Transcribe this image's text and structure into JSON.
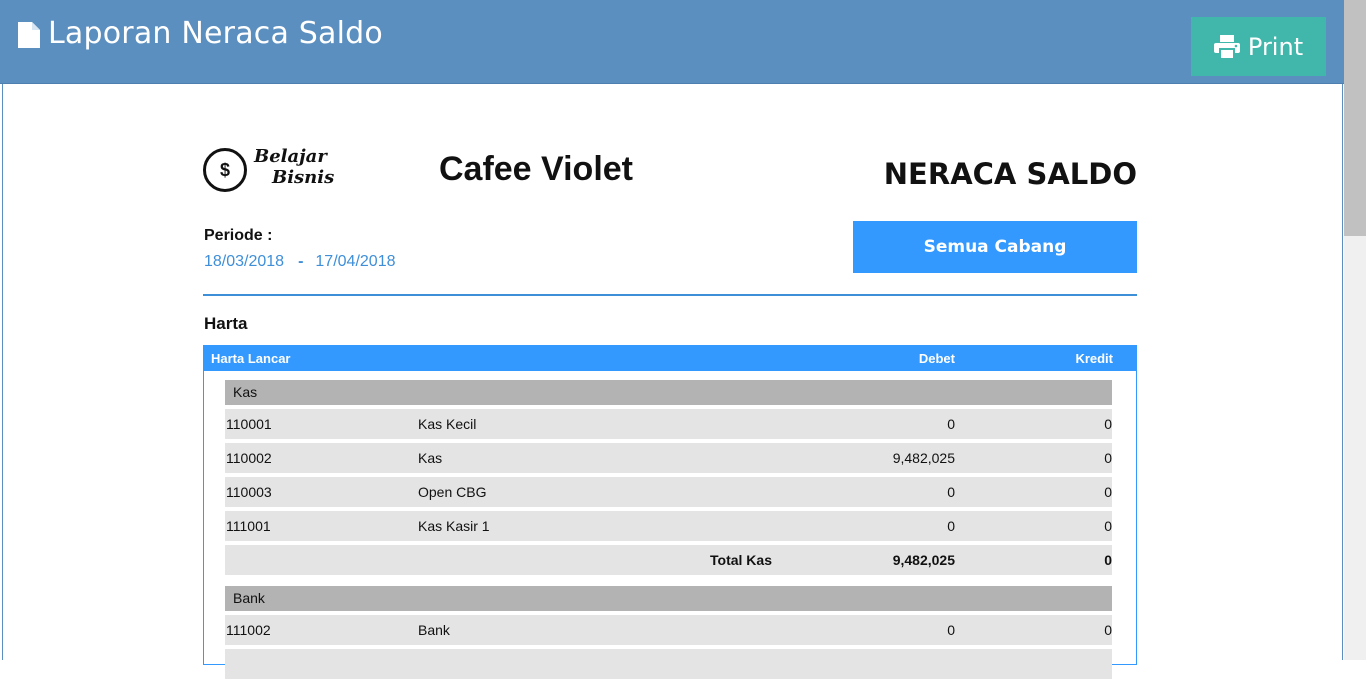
{
  "header": {
    "title": "Laporan Neraca Saldo",
    "print_label": "Print",
    "icons": [
      "document-icon",
      "printer-icon"
    ],
    "colors": {
      "bar": "#5b8fc0",
      "print_button": "#41b7ac"
    }
  },
  "report": {
    "logo_text": [
      "Belajar",
      "Bisnis"
    ],
    "company": "Cafee Violet",
    "title": "NERACA SALDO",
    "periode_label": "Periode :",
    "periode_start": "18/03/2018",
    "periode_sep": "-",
    "periode_end": "17/04/2018",
    "branch_button": "Semua  Cabang",
    "accent": "#3399ff"
  },
  "section": {
    "title": "Harta",
    "table_header": {
      "name": "Harta Lancar",
      "debet": "Debet",
      "kredit": "Kredit"
    },
    "groups": [
      {
        "name": "Kas",
        "rows": [
          {
            "code": "110001",
            "name": "Kas Kecil",
            "debet": "0",
            "kredit": "0"
          },
          {
            "code": "110002",
            "name": "Kas",
            "debet": "9,482,025",
            "kredit": "0"
          },
          {
            "code": "110003",
            "name": "Open CBG",
            "debet": "0",
            "kredit": "0"
          },
          {
            "code": "111001",
            "name": "Kas Kasir 1",
            "debet": "0",
            "kredit": "0"
          }
        ],
        "total": {
          "label": "Total Kas",
          "debet": "9,482,025",
          "kredit": "0"
        }
      },
      {
        "name": "Bank",
        "rows": [
          {
            "code": "111002",
            "name": "Bank",
            "debet": "0",
            "kredit": "0"
          }
        ]
      }
    ]
  }
}
